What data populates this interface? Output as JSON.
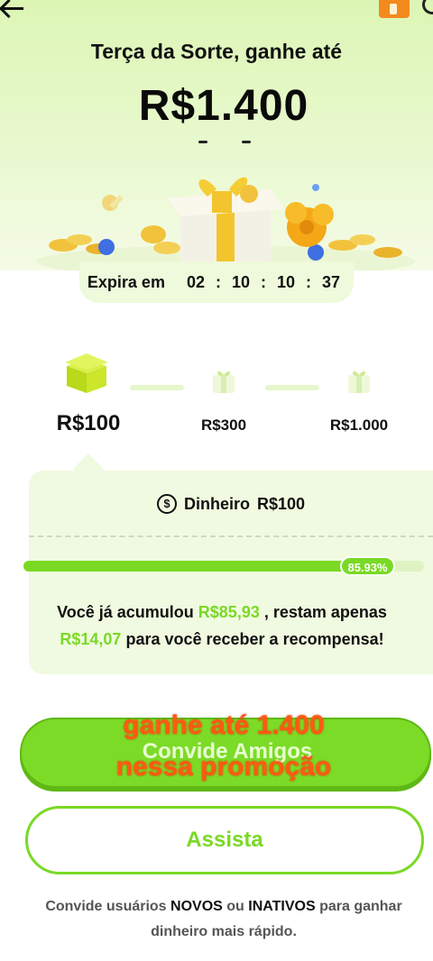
{
  "header": {
    "back_icon": "arrow-left-icon",
    "ticket_icon": "ticket-icon",
    "title": "Terça da Sorte, ganhe até",
    "amount": "R$1.400"
  },
  "timer": {
    "label": "Expira em",
    "hours": "02",
    "minutes": "10",
    "seconds_a": "10",
    "seconds_b": "37",
    "separator": ":"
  },
  "tiers": [
    {
      "label": "R$100",
      "icon": "gift-box-icon",
      "active": true
    },
    {
      "label": "R$300",
      "icon": "gift-box-icon",
      "active": false
    },
    {
      "label": "R$1.000",
      "icon": "gift-box-icon",
      "active": false
    }
  ],
  "reward_card": {
    "money_icon": "dollar-circle-icon",
    "money_label": "Dinheiro",
    "money_value": "R$100",
    "progress_percent": 85.93,
    "progress_text": "85.93%",
    "msg_part1": "Você já acumulou ",
    "msg_accumulated": "R$85,93",
    "msg_part2": " , restam apenas",
    "msg_remaining": "R$14,07",
    "msg_part3": " para você receber a recompensa!"
  },
  "buttons": {
    "invite_label": "Convide Amigos",
    "watch_label": "Assista"
  },
  "overlay": {
    "line1": "ganhe até 1.400",
    "line2": "nessa promoção"
  },
  "footer": {
    "part1": "Convide usuários ",
    "bold1": "NOVOS",
    "part2": " ou ",
    "bold2": "INATIVOS",
    "part3": " para ganhar",
    "line2": "dinheiro mais rápido."
  },
  "colors": {
    "accent_green": "#7ad925",
    "overlay_orange": "#ff5a14"
  }
}
